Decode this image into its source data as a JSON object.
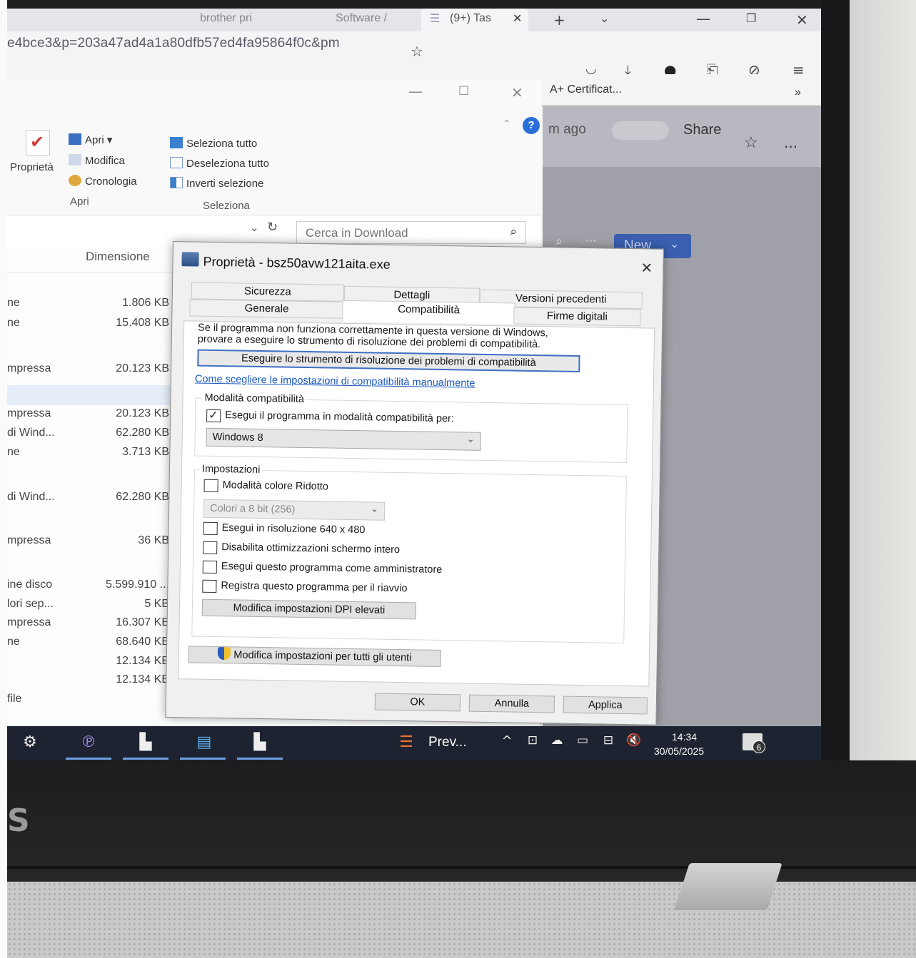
{
  "browser": {
    "tabs": [
      "brother pri",
      "Software /",
      "(9+) Tas"
    ],
    "url": "e4bce3&p=203a47ad4a1a80dfb57ed4fa95864f0c&pm",
    "bookmark": "A+ Certificat...",
    "page_meta": "m ago",
    "share_label": "Share",
    "new_label": "New",
    "more_label": "...",
    "overflow_label": "»"
  },
  "explorer": {
    "ribbon": {
      "properties_label": "Proprietà",
      "open_items": [
        "Apri ▾",
        "Modifica",
        "Cronologia"
      ],
      "open_group": "Apri",
      "select_items": [
        "Seleziona tutto",
        "Deseleziona tutto",
        "Inverti selezione"
      ],
      "select_group": "Seleziona"
    },
    "search_placeholder": "Cerca in Download",
    "size_header": "Dimensione",
    "files": [
      {
        "name": "ne",
        "size": "1.806 KB"
      },
      {
        "name": "ne",
        "size": "15.408 KB"
      },
      {
        "name": "mpressa",
        "size": "20.123 KB"
      },
      {
        "name": "mpressa",
        "size": "20.123 KB"
      },
      {
        "name": "di Wind...",
        "size": "62.280 KB"
      },
      {
        "name": "ne",
        "size": "3.713 KB"
      },
      {
        "name": "di Wind...",
        "size": "62.280 KB"
      },
      {
        "name": "mpressa",
        "size": "36 KB"
      },
      {
        "name": "ine disco",
        "size": "5.599.910 ..."
      },
      {
        "name": "lori sep...",
        "size": "5 KB"
      },
      {
        "name": "mpressa",
        "size": "16.307 KB"
      },
      {
        "name": "ne",
        "size": "68.640 KB"
      },
      {
        "name": "",
        "size": "12.134 KB"
      },
      {
        "name": "",
        "size": "12.134 KB"
      },
      {
        "name": "file",
        "size": ""
      }
    ]
  },
  "dialog": {
    "title": "Proprietà - bsz50avw121aita.exe",
    "tabs_row1": [
      "Sicurezza",
      "Dettagli",
      "Versioni precedenti"
    ],
    "tabs_row2": [
      "Generale",
      "Compatibilità",
      "Firme digitali"
    ],
    "intro_line1": "Se il programma non funziona correttamente in questa versione di Windows,",
    "intro_line2": "provare a eseguire lo strumento di risoluzione dei problemi di compatibilità.",
    "troubleshoot_button": "Eseguire lo strumento di risoluzione dei problemi di compatibilità",
    "manual_link": "Come scegliere le impostazioni di compatibilità manualmente",
    "compat_group": "Modalità compatibilità",
    "compat_checkbox": "Esegui il programma in modalità compatibilità per:",
    "compat_checked": true,
    "compat_os": "Windows 8",
    "settings_group": "Impostazioni",
    "reduced_color": "Modalità colore Ridotto",
    "color_select": "Colori a 8 bit (256)",
    "res_640": "Esegui in risoluzione 640 x 480",
    "disable_fullscreen": "Disabilita ottimizzazioni schermo intero",
    "run_admin": "Esegui questo programma come amministratore",
    "register_restart": "Registra questo programma per il riavvio",
    "dpi_button": "Modifica impostazioni DPI elevati",
    "all_users_button": "Modifica impostazioni per tutti gli utenti",
    "ok": "OK",
    "cancel": "Annulla",
    "apply": "Applica"
  },
  "taskbar": {
    "app_label": "Prev...",
    "time": "14:34",
    "date": "30/05/2025",
    "notification_count": "6"
  }
}
